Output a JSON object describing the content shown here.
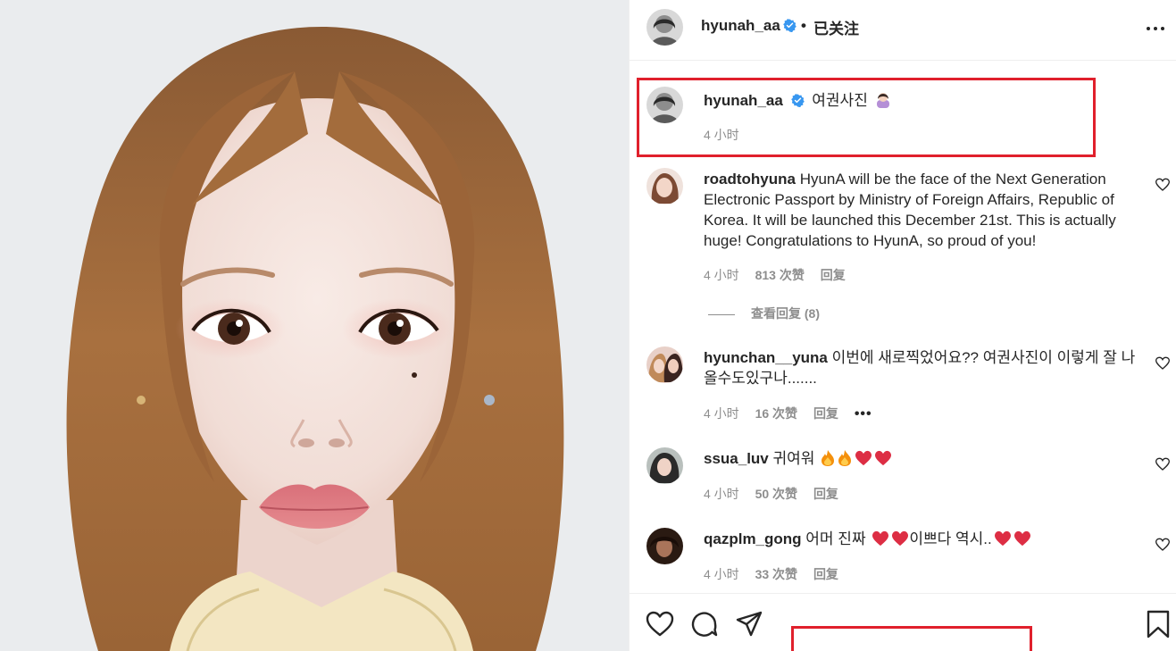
{
  "post": {
    "username": "hyunah_aa",
    "separator": "•",
    "follow_status": "已关注",
    "photo_alt": "woman portrait passport photo"
  },
  "caption": {
    "username": "hyunah_aa",
    "text": "여권사진",
    "time": "4 小时"
  },
  "comments": [
    {
      "username": "roadtohyuna",
      "text": "HyunA will be the face of the Next Generation Electronic Passport by Ministry of Foreign Affairs, Republic of Korea. It will be launched this December 21st. This is actually huge! Congratulations to HyunA, so proud of you!",
      "time": "4 小时",
      "likes": "813 次赞",
      "reply": "回复",
      "view_replies": "查看回复 (8)"
    },
    {
      "username": "hyunchan__yuna",
      "text": "이번에 새로찍었어요?? 여권사진이 이렇게 잘 나올수도있구나.......",
      "time": "4 小时",
      "likes": "16 次赞",
      "reply": "回复",
      "more": "•••"
    },
    {
      "username": "ssua_luv",
      "text": "귀여워",
      "time": "4 小时",
      "likes": "50 次赞",
      "reply": "回复"
    },
    {
      "username": "qazplm_gong",
      "text_a": "어머 진짜",
      "text_b": "이쁘다 역시..",
      "time": "4 小时",
      "likes": "33 次赞",
      "reply": "回复"
    }
  ],
  "icons": {
    "like": "heart-icon",
    "comment": "comment-icon",
    "share": "share-icon",
    "save": "bookmark-icon",
    "more": "more-icon",
    "verified": "verified-badge-icon"
  },
  "colors": {
    "highlight": "#e0202c",
    "verified": "#3897f0",
    "muted": "#8e8e8e"
  }
}
